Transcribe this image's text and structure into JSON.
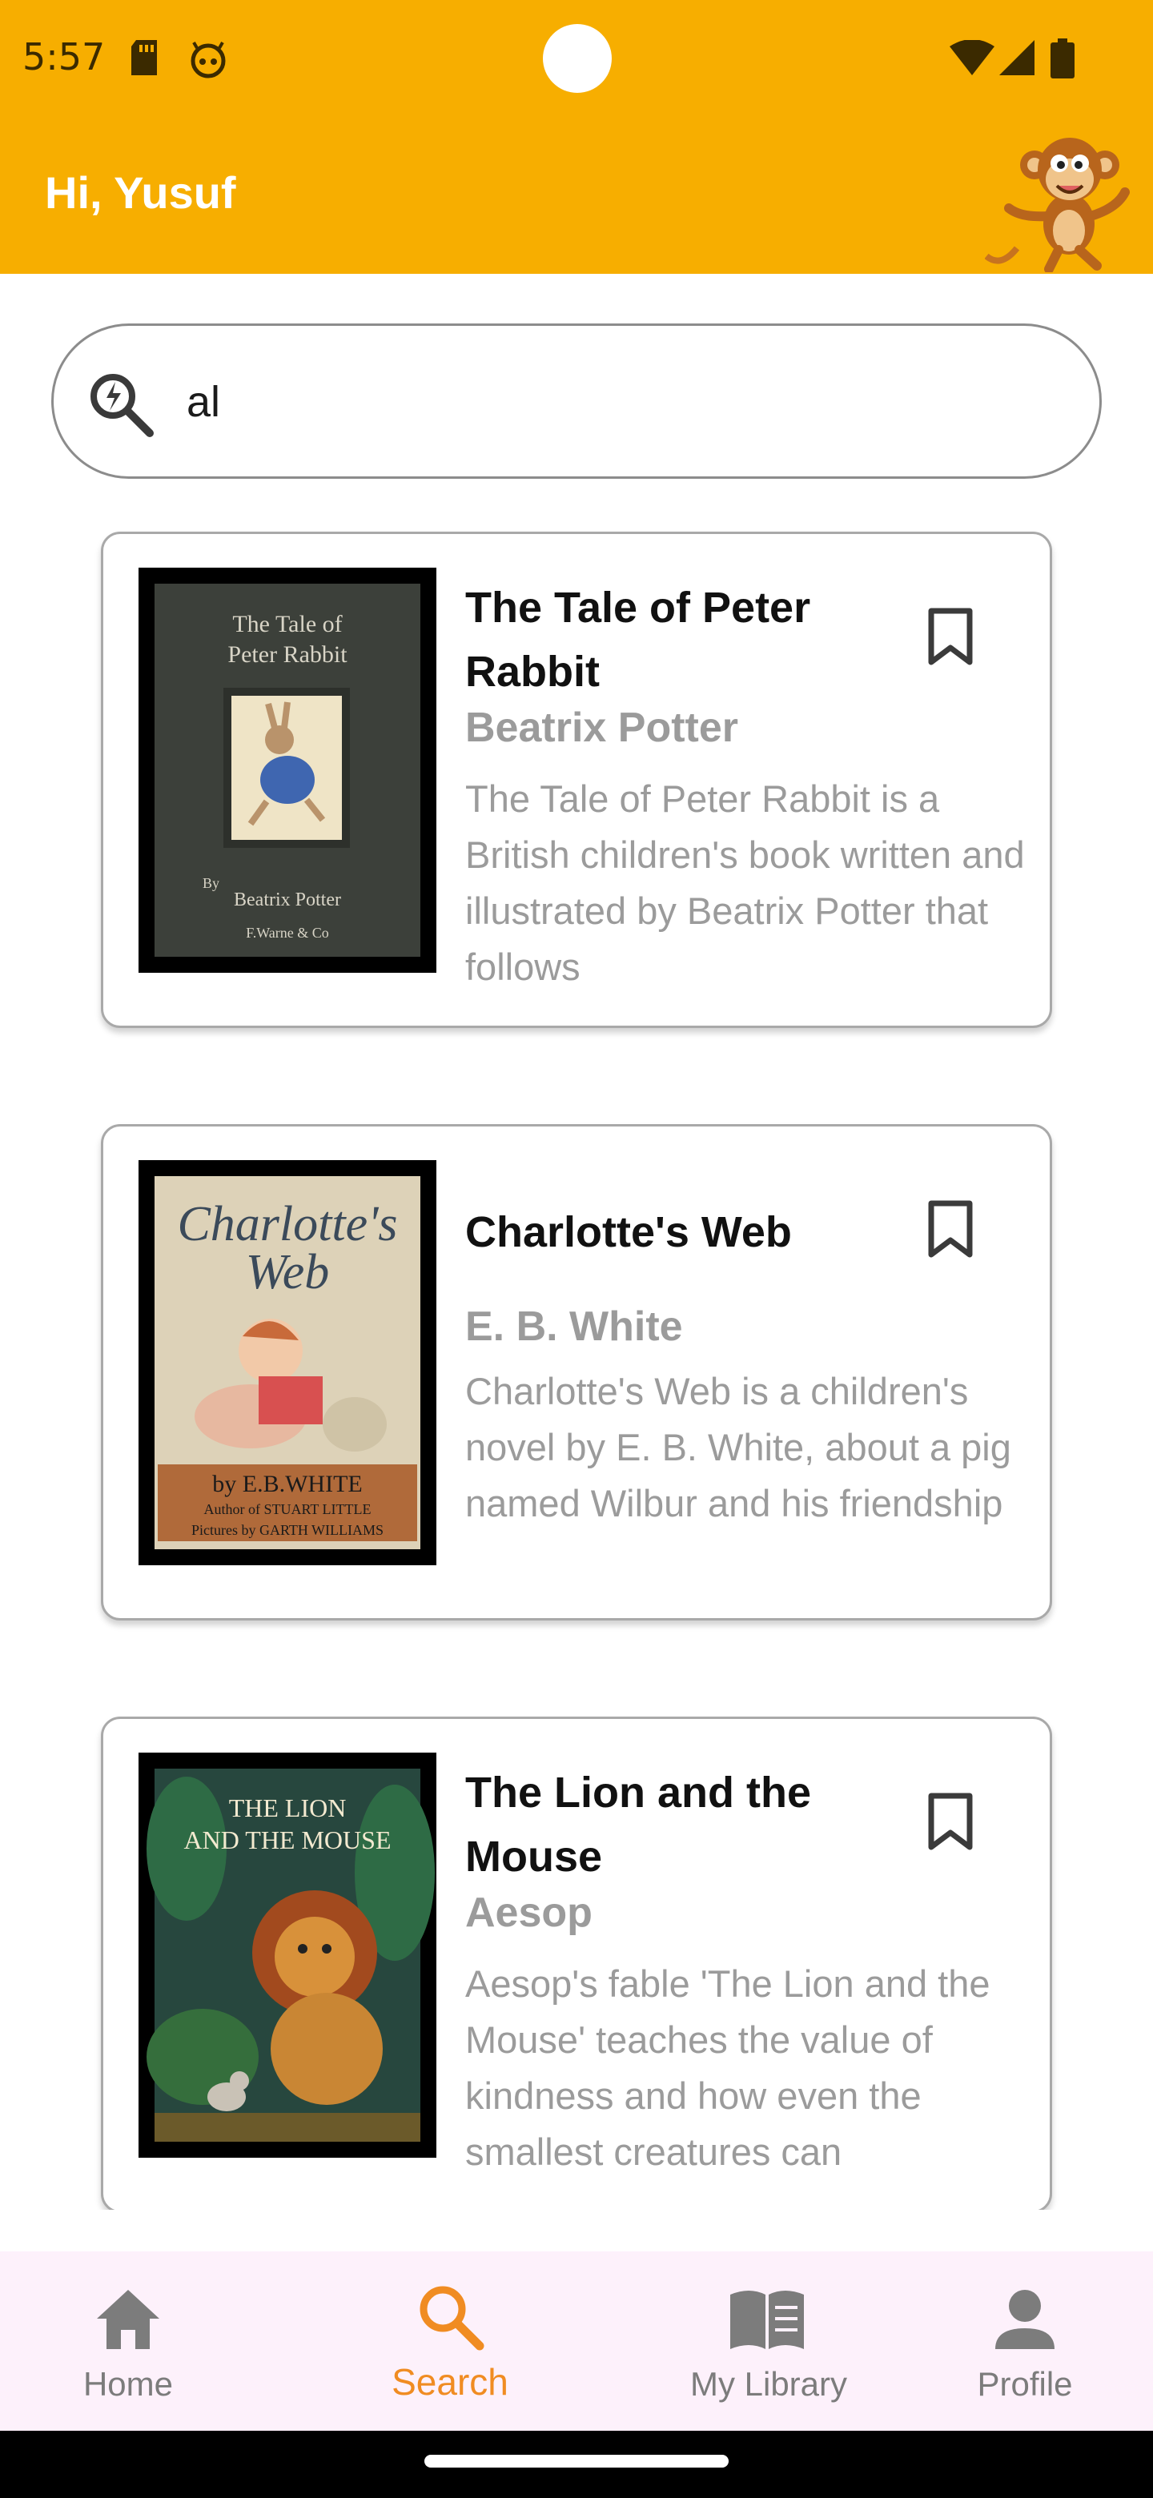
{
  "status_bar": {
    "time": "5:57"
  },
  "header": {
    "greeting": "Hi, Yusuf"
  },
  "search": {
    "query": "al"
  },
  "results": [
    {
      "cover_text": [
        "The Tale of",
        "Peter Rabbit",
        "By",
        "Beatrix Potter",
        "F.Warne & Co"
      ],
      "title": "The Tale of Peter Rabbit",
      "author": "Beatrix Potter",
      "description": "The Tale of Peter Rabbit is a British children's book written and illustrated by Beatrix Potter that follows"
    },
    {
      "cover_text": [
        "Charlotte's",
        "Web",
        "by E.B.WHITE",
        "Author of STUART LITTLE",
        "Pictures by GARTH WILLIAMS"
      ],
      "title": "Charlotte's Web",
      "author": "E. B. White",
      "description": "Charlotte's Web is a children's novel by E. B. White, about a pig named Wilbur and his friendship"
    },
    {
      "cover_text": [
        "THE LION",
        "AND THE MOUSE"
      ],
      "title": "The Lion and the Mouse",
      "author": "Aesop",
      "description": "Aesop's fable 'The Lion and the Mouse' teaches the value of kindness and how even the smallest creatures can"
    }
  ],
  "bottom_nav": [
    {
      "label": "Home",
      "icon": "home-icon"
    },
    {
      "label": "Search",
      "icon": "search-icon",
      "active": true
    },
    {
      "label": "My Library",
      "icon": "library-icon"
    },
    {
      "label": "Profile",
      "icon": "profile-icon"
    }
  ],
  "colors": {
    "app_bar": "#f7ae00",
    "active_nav": "#f08c22",
    "muted_text": "#9b9b9b",
    "nav_background": "#fdf1fb"
  }
}
